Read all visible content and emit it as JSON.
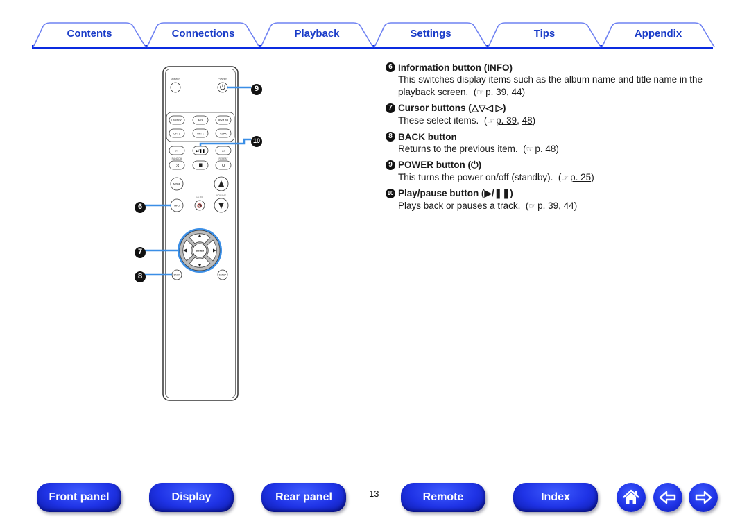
{
  "tabs": [
    {
      "label": "Contents"
    },
    {
      "label": "Connections"
    },
    {
      "label": "Playback"
    },
    {
      "label": "Settings"
    },
    {
      "label": "Tips"
    },
    {
      "label": "Appendix"
    }
  ],
  "remote": {
    "labels": {
      "dimmer": "DIMMER",
      "power": "POWER",
      "usb_disc": "USB/DISC",
      "aux": "AUX",
      "ipod_usb": "iPod/USB",
      "opt1": "OPT 1",
      "opt2": "OPT 2",
      "coax": "COAX",
      "random": "RANDOM",
      "repeat": "REPEAT",
      "mode": "MODE",
      "mute": "MUTE",
      "volume": "VOLUME",
      "info": "INFO",
      "enter": "ENTER",
      "back": "BACK",
      "setup": "SETUP"
    },
    "callouts": [
      {
        "num": "6",
        "target": "INFO"
      },
      {
        "num": "7",
        "target": "Cursor"
      },
      {
        "num": "8",
        "target": "BACK"
      },
      {
        "num": "9",
        "target": "POWER"
      },
      {
        "num": "10",
        "target": "Play/pause"
      }
    ]
  },
  "items": [
    {
      "num": "6",
      "title": "Information button (INFO)",
      "body": "This switches display items such as the album name and title name in the playback screen.",
      "ref_prefix": "(",
      "page": "p. 39",
      "sep": ", ",
      "page2": "44",
      "ref_suffix": ")"
    },
    {
      "num": "7",
      "title": "Cursor buttons (△▽◁ ▷)",
      "body": "These select items.",
      "ref_prefix": "(",
      "page": "p. 39",
      "sep": ", ",
      "page2": "48",
      "ref_suffix": ")"
    },
    {
      "num": "8",
      "title": "BACK button",
      "body": "Returns to the previous item.",
      "ref_prefix": "(",
      "page": "p. 48",
      "sep": "",
      "page2": "",
      "ref_suffix": ")"
    },
    {
      "num": "9",
      "title": "POWER button (⏻)",
      "body": "This turns the power on/off (standby).",
      "ref_prefix": "(",
      "page": "p. 25",
      "sep": "",
      "page2": "",
      "ref_suffix": ")"
    },
    {
      "num": "10",
      "title": "Play/pause button (▶/❚❚)",
      "body": "Plays back or pauses a track.",
      "ref_prefix": "(",
      "page": "p. 39",
      "sep": ", ",
      "page2": "44",
      "ref_suffix": ")"
    }
  ],
  "bottom_nav": {
    "front_panel": "Front panel",
    "display": "Display",
    "rear_panel": "Rear panel",
    "page_number": "13",
    "remote": "Remote",
    "index": "Index"
  },
  "colors": {
    "accent": "#0a2be0",
    "tab_text": "#1a3cc8",
    "callout_line": "#3a8ee6"
  }
}
